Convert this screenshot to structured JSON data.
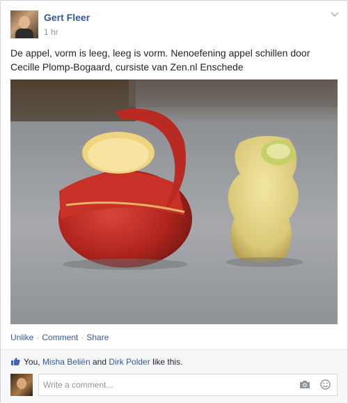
{
  "post": {
    "author": "Gert Fleer",
    "time": "1 hr",
    "text": "De appel, vorm is leeg, leeg is vorm. Nenoefening appel schillen door Cecille Plomp-Bogaard, cursiste van Zen.nl Enschede"
  },
  "actions": {
    "unlike": "Unlike",
    "comment": "Comment",
    "share": "Share"
  },
  "likes": {
    "you": "You,",
    "person1": "Misha Beliën",
    "and": "and",
    "person2": "Dirk Polder",
    "suffix": "like this."
  },
  "comment_box": {
    "placeholder": "Write a comment..."
  },
  "icons": {
    "chevron": "chevron-down-icon",
    "like": "thumbs-up-icon",
    "camera": "camera-icon",
    "emoji": "smiley-icon"
  },
  "colors": {
    "link": "#365899",
    "meta": "#90949c",
    "text": "#1d2129"
  }
}
